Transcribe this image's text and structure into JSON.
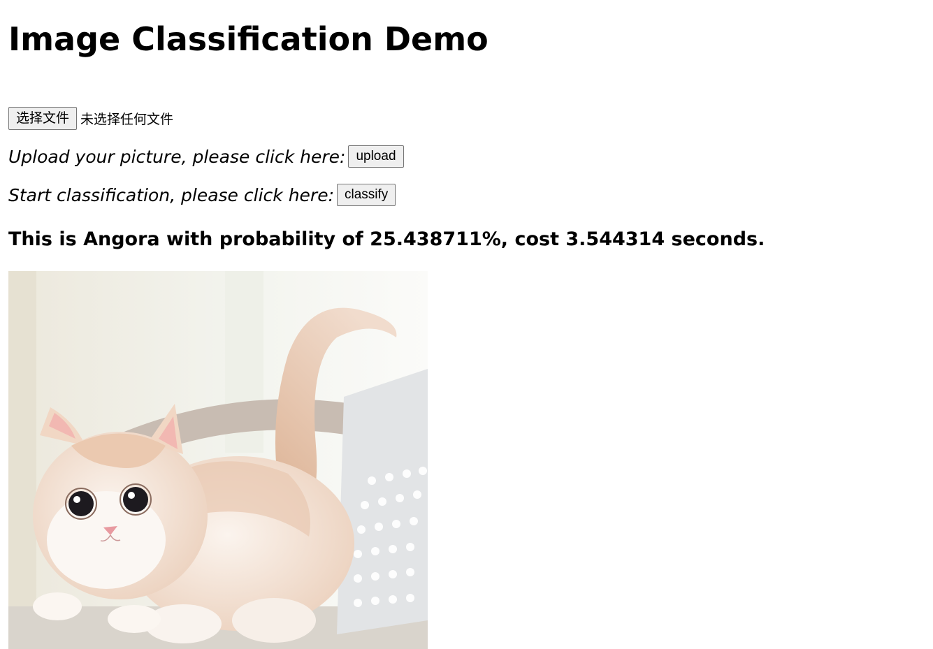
{
  "page": {
    "title": "Image Classification Demo"
  },
  "file_input": {
    "button_label": "选择文件",
    "status": "未选择任何文件"
  },
  "upload": {
    "prompt": "Upload your picture, please click here:",
    "button_label": "upload"
  },
  "classify": {
    "prompt": "Start classification, please click here:",
    "button_label": "classify"
  },
  "result": {
    "text": "This is Angora with probability of 25.438711%, cost 3.544314 seconds."
  },
  "image": {
    "subject": "cream-and-white kitten photo"
  }
}
